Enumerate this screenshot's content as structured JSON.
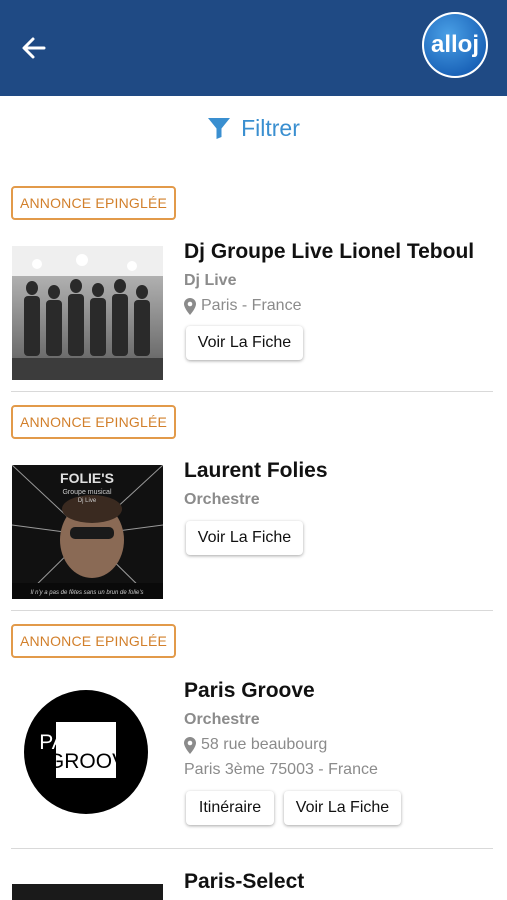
{
  "header": {
    "logo_text": "alloj"
  },
  "filter": {
    "label": "Filtrer"
  },
  "listings": [
    {
      "badge": "ANNONCE EPINGLÉE",
      "title": "Dj Groupe Live Lionel Teboul",
      "category": "Dj Live",
      "location": "Paris - France",
      "buttons": [
        "Voir La Fiche"
      ]
    },
    {
      "badge": "ANNONCE EPINGLÉE",
      "title": "Laurent Folies",
      "category": "Orchestre",
      "image_text": {
        "brand": "FOLIE'S",
        "subtitle": "Groupe musical",
        "subtitle2": "Dj Live",
        "tagline": "Il n'y a pas de fêtes sans un brun de folie's"
      },
      "buttons": [
        "Voir La Fiche"
      ]
    },
    {
      "badge": "ANNONCE EPINGLÉE",
      "title": "Paris Groove",
      "category": "Orchestre",
      "address": "58 rue beaubourg",
      "city": "Paris 3ème 75003 - France",
      "logo_text": {
        "line1": "PARIS",
        "line2": "GROOVE"
      },
      "buttons": [
        "Itinéraire",
        "Voir La Fiche"
      ]
    },
    {
      "title": "Paris-Select"
    }
  ],
  "colors": {
    "appbar": "#1f4a84",
    "accent_blue": "#3a8fd0",
    "badge_orange": "#e29a4a",
    "muted_text": "#8b8b8b"
  },
  "icons": [
    "back-arrow-icon",
    "filter-funnel-icon",
    "map-pin-icon"
  ]
}
